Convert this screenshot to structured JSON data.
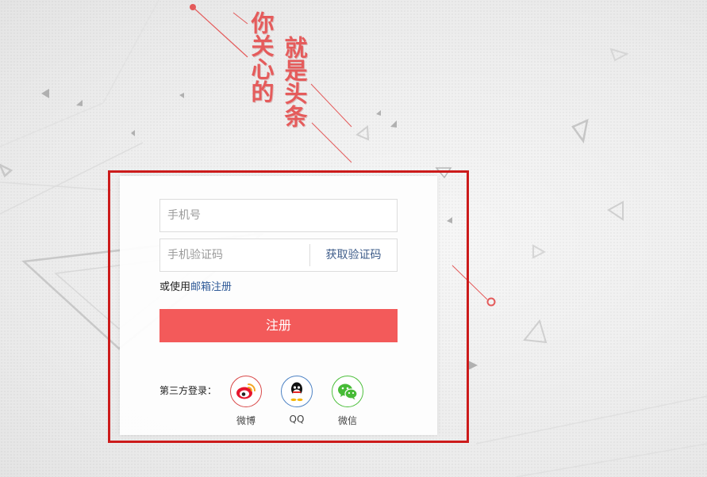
{
  "slogan": {
    "line1": "你关心的",
    "line2": "就是头条"
  },
  "form": {
    "phone_placeholder": "手机号",
    "code_placeholder": "手机验证码",
    "get_code_label": "获取验证码",
    "alt_prefix": "或使用",
    "alt_link": "邮箱注册",
    "register_label": "注册"
  },
  "third_party": {
    "label": "第三方登录：",
    "items": [
      {
        "name": "微博",
        "icon": "weibo-icon",
        "color": "#d94848"
      },
      {
        "name": "QQ",
        "icon": "qq-icon",
        "color": "#4d82c4"
      },
      {
        "name": "微信",
        "icon": "wechat-icon",
        "color": "#4cbf3b"
      }
    ]
  },
  "colors": {
    "accent": "#f35a5a",
    "slogan": "#e55b5b",
    "frame": "#cc1b1b",
    "link": "#2f5a98"
  }
}
